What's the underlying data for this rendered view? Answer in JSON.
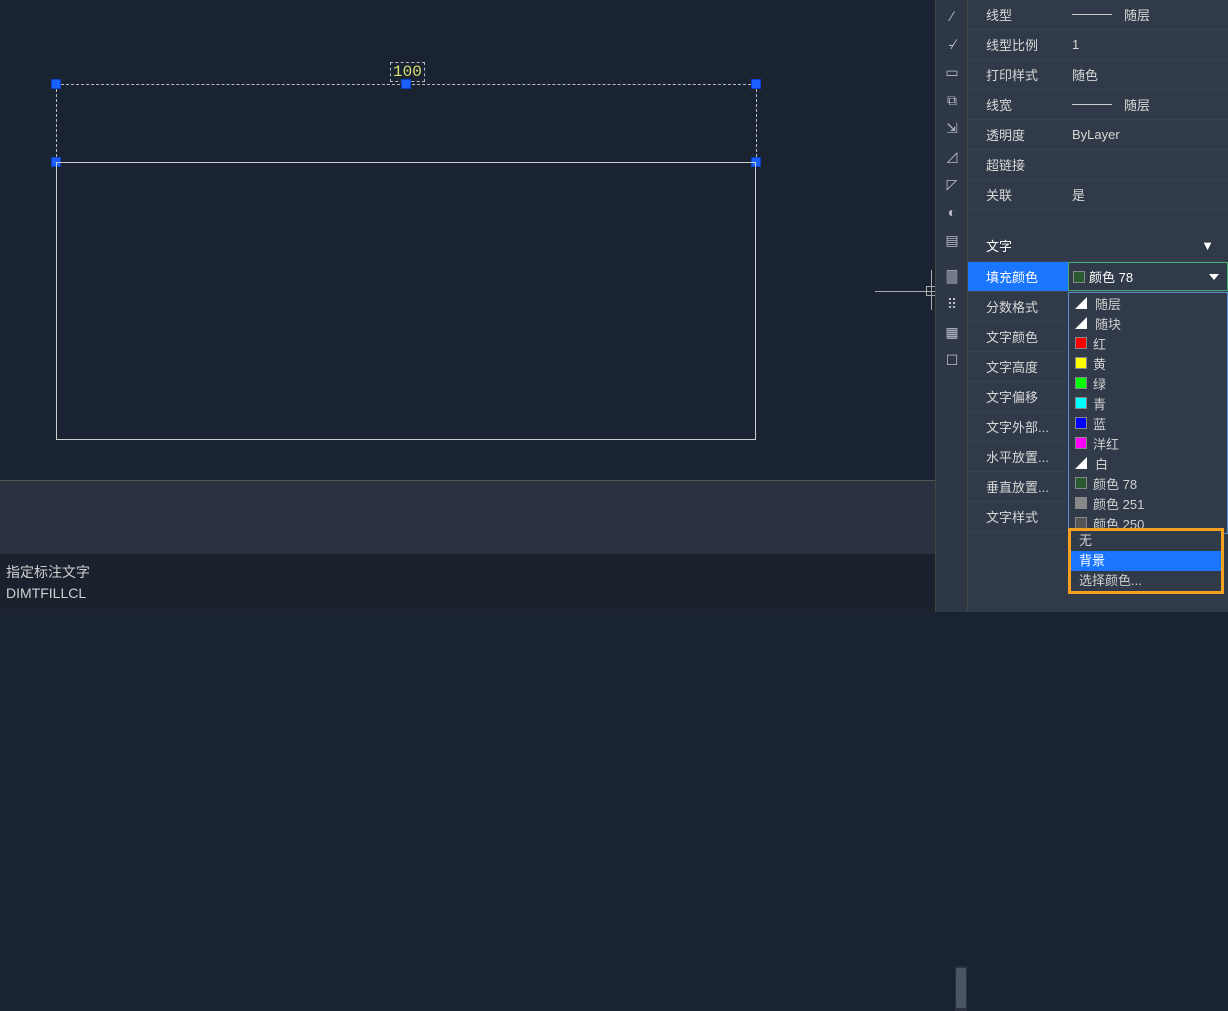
{
  "canvas": {
    "dimension_value": "100"
  },
  "properties_general": [
    {
      "label": "线型",
      "value_type": "line",
      "value_text": "随层"
    },
    {
      "label": "线型比例",
      "value_type": "text",
      "value_text": "1"
    },
    {
      "label": "打印样式",
      "value_type": "text",
      "value_text": "随色"
    },
    {
      "label": "线宽",
      "value_type": "line",
      "value_text": "随层"
    },
    {
      "label": "透明度",
      "value_type": "text",
      "value_text": "ByLayer"
    },
    {
      "label": "超链接",
      "value_type": "text",
      "value_text": ""
    },
    {
      "label": "关联",
      "value_type": "text",
      "value_text": "是"
    }
  ],
  "section_text": {
    "header": "文字"
  },
  "fill_row": {
    "label": "填充颜色",
    "value": "颜色 78"
  },
  "properties_text_group": [
    {
      "label": "分数格式"
    },
    {
      "label": "文字颜色"
    },
    {
      "label": "文字高度"
    },
    {
      "label": "文字偏移"
    },
    {
      "label": "文字外部..."
    },
    {
      "label": "水平放置..."
    },
    {
      "label": "垂直放置..."
    },
    {
      "label": "文字样式"
    }
  ],
  "color_options": [
    {
      "name": "随层",
      "swatch_type": "tri",
      "color": "#fff"
    },
    {
      "name": "随块",
      "swatch_type": "tri",
      "color": "#fff"
    },
    {
      "name": "红",
      "swatch_type": "box",
      "color": "#ff0000"
    },
    {
      "name": "黄",
      "swatch_type": "box",
      "color": "#ffff00"
    },
    {
      "name": "绿",
      "swatch_type": "box",
      "color": "#00ff00"
    },
    {
      "name": "青",
      "swatch_type": "box",
      "color": "#00ffff"
    },
    {
      "name": "蓝",
      "swatch_type": "box",
      "color": "#0000ff"
    },
    {
      "name": "洋红",
      "swatch_type": "box",
      "color": "#ff00ff"
    },
    {
      "name": "白",
      "swatch_type": "tri",
      "color": "#fff"
    },
    {
      "name": "颜色 78",
      "swatch_type": "box",
      "color": "#2a5a32"
    },
    {
      "name": "颜色 251",
      "swatch_type": "box",
      "color": "#888"
    },
    {
      "name": "颜色 250",
      "swatch_type": "box",
      "color": "#555"
    }
  ],
  "fill_options": {
    "items": [
      "无",
      "背景",
      "选择颜色..."
    ],
    "selected": 1
  },
  "command": {
    "l1": "指定标注文字",
    "l2": "DIMTFILLCL"
  }
}
